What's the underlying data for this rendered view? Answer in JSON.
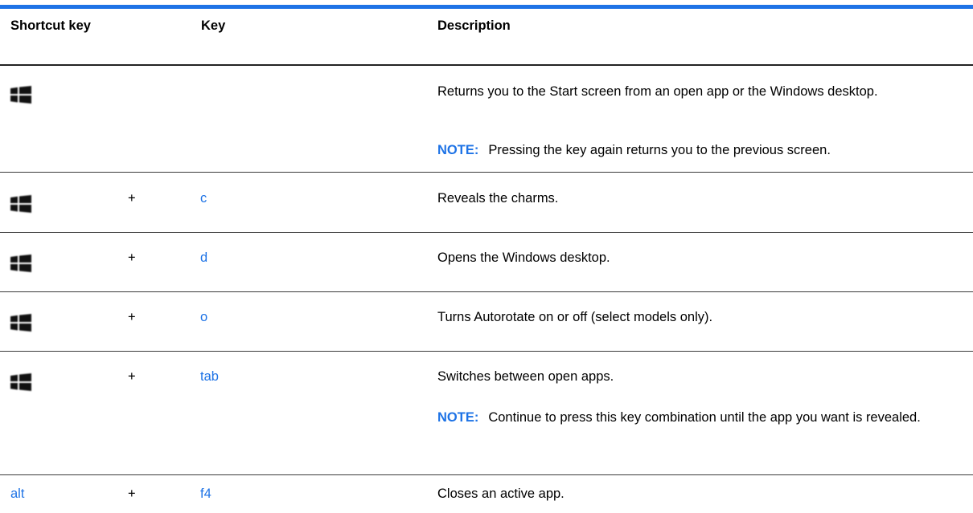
{
  "table": {
    "headers": {
      "shortcut_key": "Shortcut key",
      "key": "Key",
      "description": "Description"
    },
    "rows": [
      {
        "shortcut_icon": "windows-logo-icon",
        "plus": "",
        "key": "",
        "description": "Returns you to the Start screen from an open app or the Windows desktop.",
        "note_label": "NOTE:",
        "note_text": "Pressing the key again returns you to the previous screen."
      },
      {
        "shortcut_icon": "windows-logo-icon",
        "plus": "+",
        "key": "c",
        "description": "Reveals the charms."
      },
      {
        "shortcut_icon": "windows-logo-icon",
        "plus": "+",
        "key": "d",
        "description": "Opens the Windows desktop."
      },
      {
        "shortcut_icon": "windows-logo-icon",
        "plus": "+",
        "key": "o",
        "description": "Turns Autorotate on or off (select models only)."
      },
      {
        "shortcut_icon": "windows-logo-icon",
        "plus": "+",
        "key": "tab",
        "description": "Switches between open apps.",
        "note_label": "NOTE:",
        "note_text": "Continue to press this key combination until the app you want is revealed."
      },
      {
        "shortcut_text": "alt",
        "plus": "+",
        "key": "f4",
        "description": "Closes an active app."
      }
    ]
  },
  "colors": {
    "accent": "#1e73e6",
    "text": "#000000",
    "rule": "#3a3a3a"
  }
}
